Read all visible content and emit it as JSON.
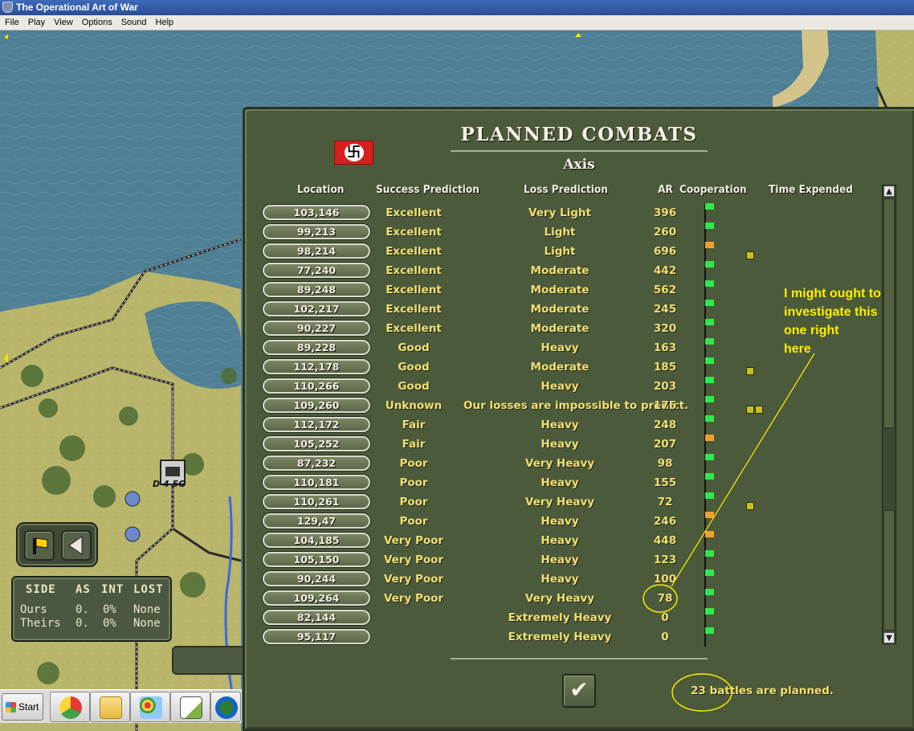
{
  "window": {
    "title": "The Operational Art of War"
  },
  "menu": [
    "File",
    "Play",
    "View",
    "Options",
    "Sound",
    "Help"
  ],
  "map_hud": {
    "stats": {
      "headers": [
        "SIDE",
        "AS",
        "INT",
        "LOST"
      ],
      "rows": [
        {
          "side": "Ours",
          "as": "0.",
          "int": "0%",
          "lost": "None"
        },
        {
          "side": "Theirs",
          "as": "0.",
          "int": "0%",
          "lost": "None"
        }
      ]
    },
    "unit_label": "D 4 5G"
  },
  "taskbar": {
    "start_label": "Start",
    "items": [
      "chrome-icon",
      "folder-icon",
      "paint-icon",
      "chart-app-icon",
      "globe-icon"
    ]
  },
  "dialog": {
    "title": "PLANNED COMBATS",
    "side": "Axis",
    "columns": {
      "location": "Location",
      "success": "Success Prediction",
      "loss": "Loss Prediction",
      "ar": "AR",
      "coop": "Cooperation",
      "time": "Time Expended"
    },
    "rows": [
      {
        "loc": "103,146",
        "succ": "Excellent",
        "loss": "Very Light",
        "ar": "396",
        "coop": "green",
        "time": 0
      },
      {
        "loc": "99,213",
        "succ": "Excellent",
        "loss": "Light",
        "ar": "260",
        "coop": "green",
        "time": 0
      },
      {
        "loc": "98,214",
        "succ": "Excellent",
        "loss": "Light",
        "ar": "696",
        "coop": "orange",
        "time": 1
      },
      {
        "loc": "77,240",
        "succ": "Excellent",
        "loss": "Moderate",
        "ar": "442",
        "coop": "green",
        "time": 0
      },
      {
        "loc": "89,248",
        "succ": "Excellent",
        "loss": "Moderate",
        "ar": "562",
        "coop": "green",
        "time": 0
      },
      {
        "loc": "102,217",
        "succ": "Excellent",
        "loss": "Moderate",
        "ar": "245",
        "coop": "green",
        "time": 0
      },
      {
        "loc": "90,227",
        "succ": "Excellent",
        "loss": "Moderate",
        "ar": "320",
        "coop": "green",
        "time": 0
      },
      {
        "loc": "89,228",
        "succ": "Good",
        "loss": "Heavy",
        "ar": "163",
        "coop": "green",
        "time": 0
      },
      {
        "loc": "112,178",
        "succ": "Good",
        "loss": "Moderate",
        "ar": "185",
        "coop": "green",
        "time": 1
      },
      {
        "loc": "110,266",
        "succ": "Good",
        "loss": "Heavy",
        "ar": "203",
        "coop": "green",
        "time": 0
      },
      {
        "loc": "109,260",
        "succ": "Unknown",
        "loss": "Our losses are impossible to predict.",
        "ar": "176",
        "coop": "green",
        "time": 2
      },
      {
        "loc": "112,172",
        "succ": "Fair",
        "loss": "Heavy",
        "ar": "248",
        "coop": "green",
        "time": 0
      },
      {
        "loc": "105,252",
        "succ": "Fair",
        "loss": "Heavy",
        "ar": "207",
        "coop": "orange",
        "time": 0
      },
      {
        "loc": "87,232",
        "succ": "Poor",
        "loss": "Very Heavy",
        "ar": "98",
        "coop": "green",
        "time": 0
      },
      {
        "loc": "110,181",
        "succ": "Poor",
        "loss": "Heavy",
        "ar": "155",
        "coop": "green",
        "time": 0
      },
      {
        "loc": "110,261",
        "succ": "Poor",
        "loss": "Very Heavy",
        "ar": "72",
        "coop": "green",
        "time": 1
      },
      {
        "loc": "129,47",
        "succ": "Poor",
        "loss": "Heavy",
        "ar": "246",
        "coop": "orange",
        "time": 0
      },
      {
        "loc": "104,185",
        "succ": "Very Poor",
        "loss": "Heavy",
        "ar": "448",
        "coop": "orange",
        "time": 0
      },
      {
        "loc": "105,150",
        "succ": "Very Poor",
        "loss": "Heavy",
        "ar": "123",
        "coop": "green",
        "time": 0
      },
      {
        "loc": "90,244",
        "succ": "Very Poor",
        "loss": "Heavy",
        "ar": "100",
        "coop": "green",
        "time": 0
      },
      {
        "loc": "109,264",
        "succ": "Very Poor",
        "loss": "Very Heavy",
        "ar": "78",
        "coop": "green",
        "time": 0
      },
      {
        "loc": "82,144",
        "succ": "",
        "loss": "Extremely Heavy",
        "ar": "0",
        "coop": "green",
        "time": 0
      },
      {
        "loc": "95,117",
        "succ": "",
        "loss": "Extremely Heavy",
        "ar": "0",
        "coop": "green",
        "time": 0
      }
    ],
    "status": "23 battles are planned.",
    "flag_colors": {
      "green": "#2fe84a",
      "orange": "#f0a030"
    }
  },
  "annotation": {
    "lines": [
      "I might ought to",
      "investigate this",
      "one right",
      "here"
    ],
    "color": "#ffee00"
  }
}
